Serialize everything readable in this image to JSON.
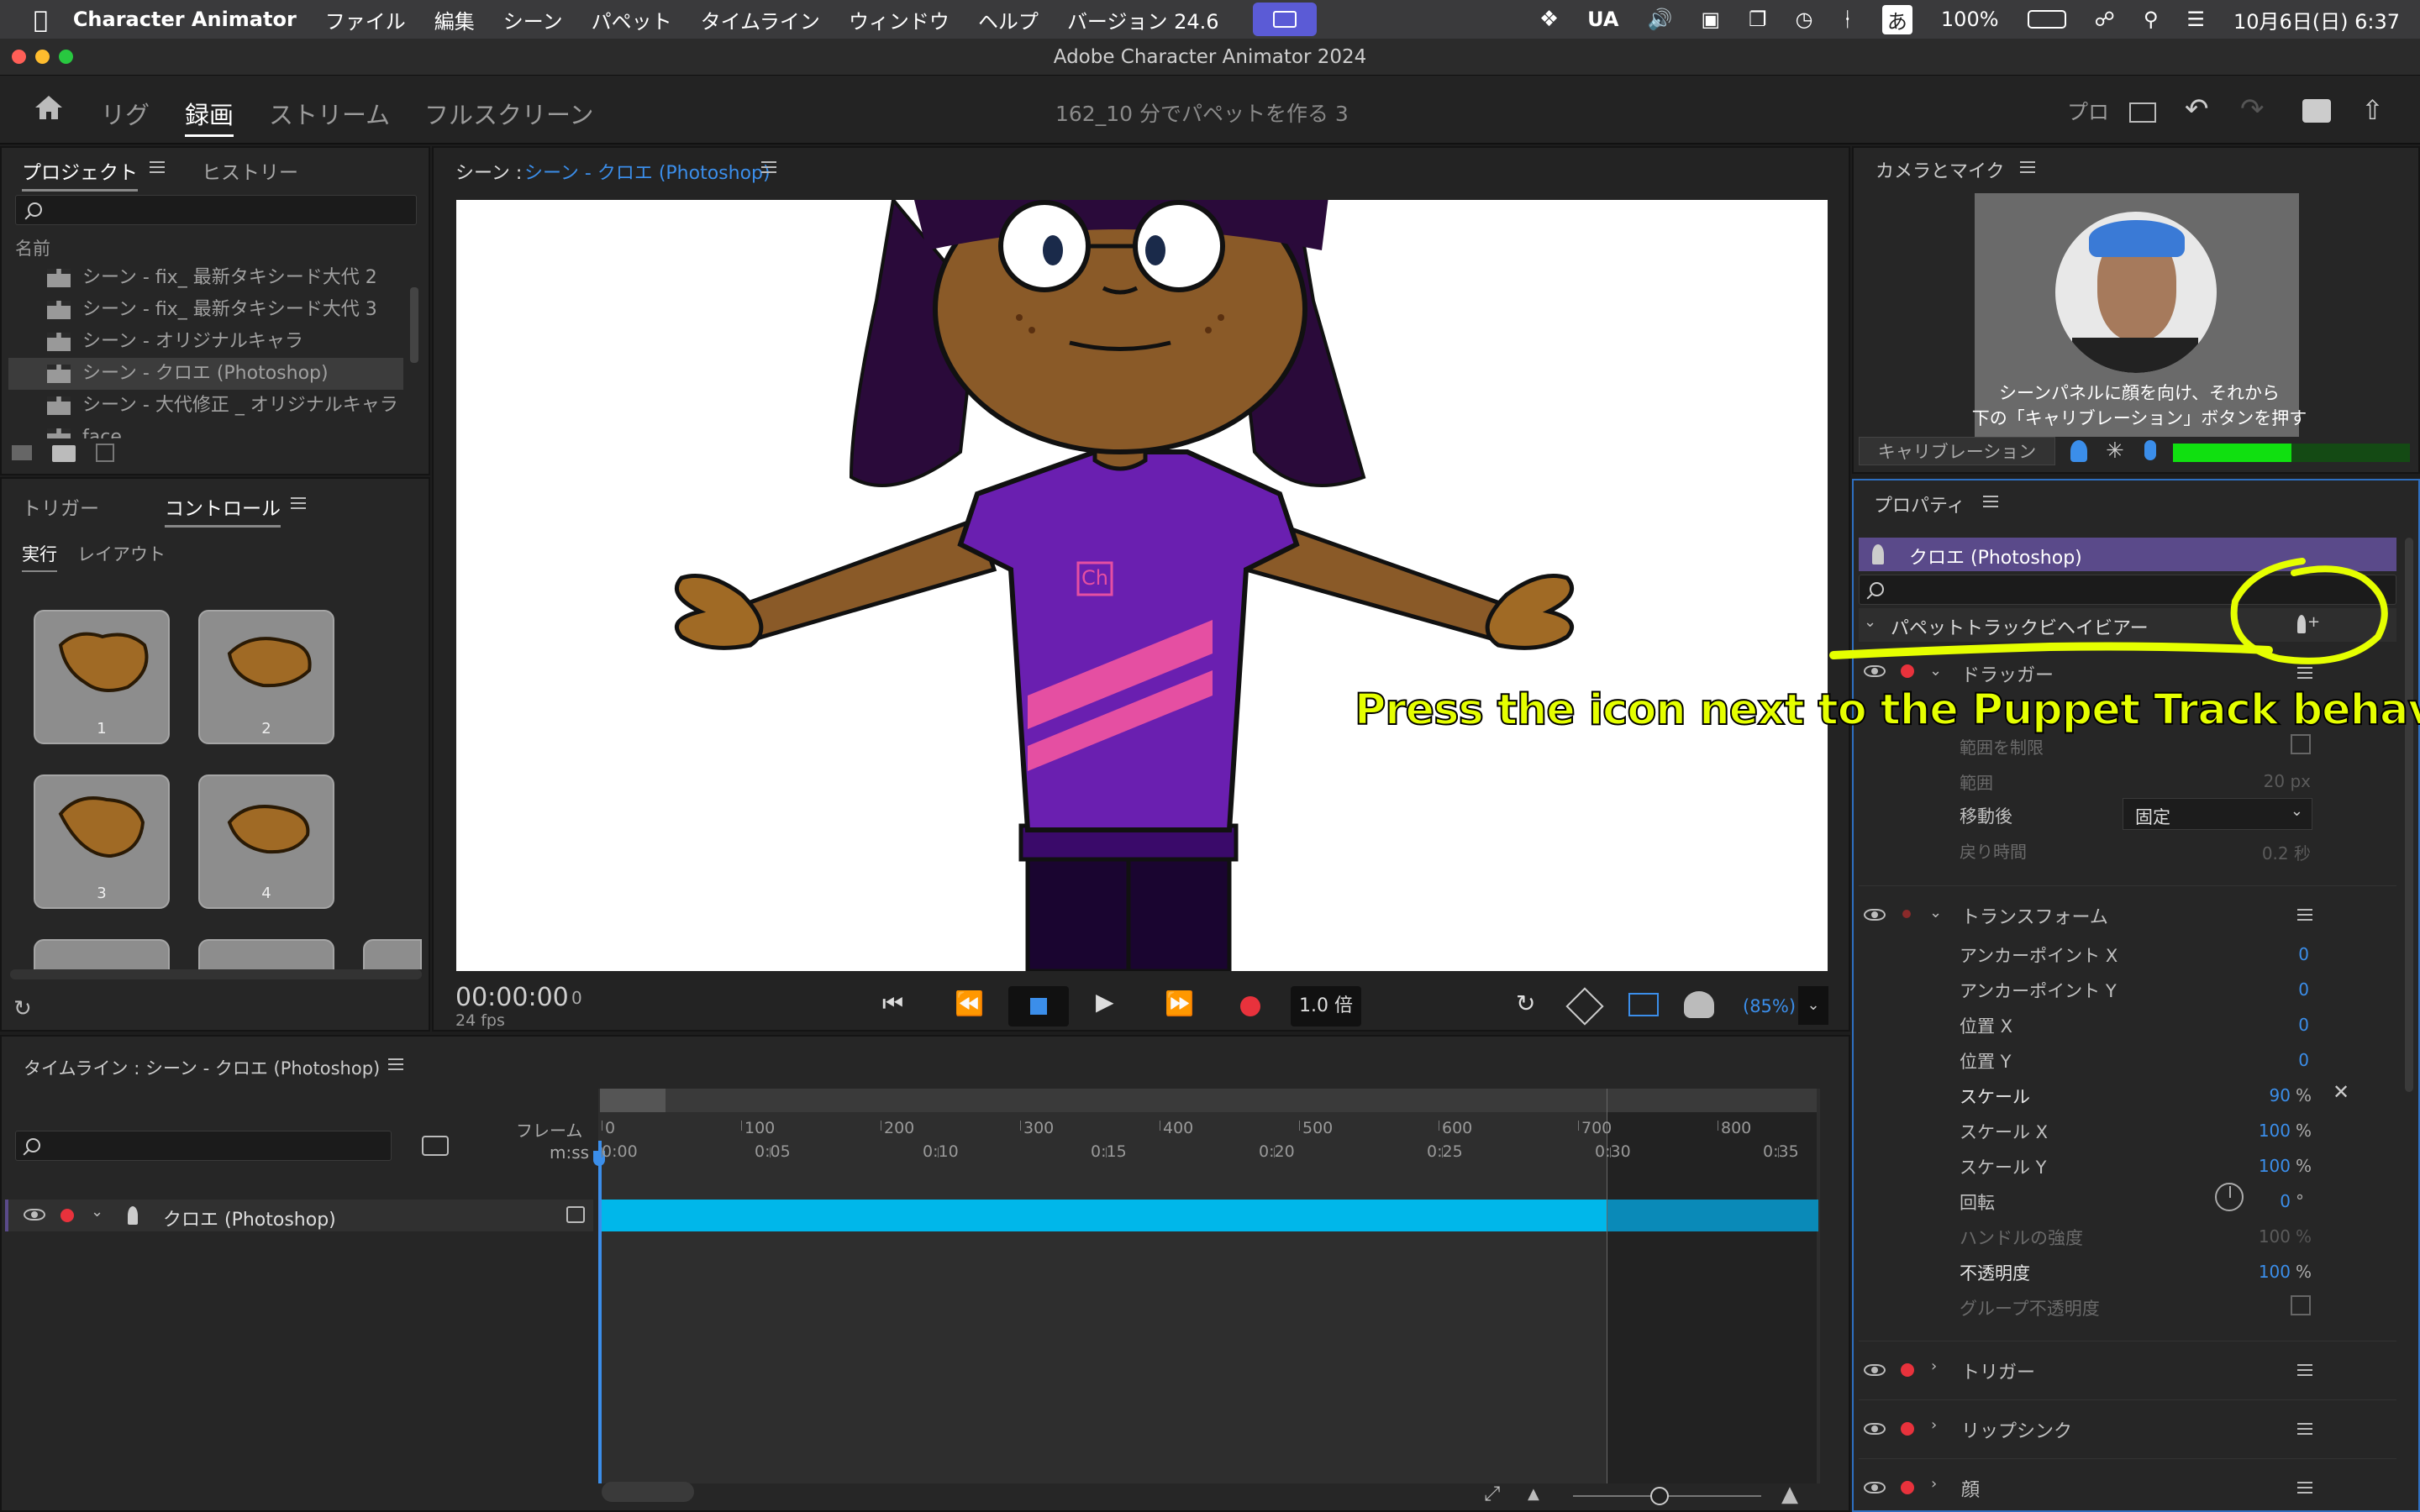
{
  "menubar": {
    "app_name": "Character Animator",
    "items": [
      "ファイル",
      "編集",
      "シーン",
      "パペット",
      "タイムライン",
      "ウィンドウ",
      "ヘルプ",
      "バージョン 24.6"
    ],
    "lang": "UA",
    "ime": "あ",
    "battery": "100%",
    "clock": "10月6日(日) 6:37"
  },
  "window": {
    "title": "Adobe Character Animator 2024"
  },
  "workspace": {
    "tabs": [
      "リグ",
      "録画",
      "ストリーム",
      "フルスクリーン"
    ],
    "active": "録画",
    "doc_title": "162_10 分でパペットを作る 3",
    "pro_label": "プロ"
  },
  "project_panel": {
    "tabs": [
      "プロジェクト",
      "ヒストリー"
    ],
    "column_header": "名前",
    "items": [
      {
        "label": "シーン - fix_ 最新タキシード大代 2",
        "selected": false
      },
      {
        "label": "シーン - fix_ 最新タキシード大代 3",
        "selected": false
      },
      {
        "label": "シーン - オリジナルキャラ",
        "selected": false
      },
      {
        "label": "シーン - クロエ (Photoshop)",
        "selected": true
      },
      {
        "label": "シーン - 大代修正 _ オリジナルキャラ",
        "selected": false
      },
      {
        "label": "face",
        "selected": false
      }
    ]
  },
  "controls_panel": {
    "tabs": [
      "トリガー",
      "コントロール"
    ],
    "subtabs": [
      "実行",
      "レイアウト"
    ],
    "tiles": [
      "1",
      "2",
      "3",
      "4"
    ]
  },
  "scene_panel": {
    "label_prefix": "シーン :",
    "scene_name": "シーン - クロエ (Photoshop)",
    "shirt_logo": "Ch",
    "timecode": "00:00:00",
    "frame": "0",
    "fps": "24 fps",
    "speed": "1.0 倍",
    "zoom": "(85%)"
  },
  "camera_panel": {
    "title": "カメラとマイク",
    "instruction_line1": "シーンパネルに顔を向け、それから",
    "instruction_line2": "下の「キャリブレーション」ボタンを押す",
    "calibrate_button": "キャリブレーション",
    "mic_level": 0.5
  },
  "properties_panel": {
    "title": "プロパティ",
    "puppet_name": "クロエ (Photoshop)",
    "behavior_header": "パペットトラックビヘイビアー",
    "dragger": {
      "label": "ドラッガー",
      "limit_label": "範囲を制限",
      "range_label": "範囲",
      "range_value": "20 px",
      "after_move_label": "移動後",
      "after_move_value": "固定",
      "return_time_label": "戻り時間",
      "return_time_value": "0.2 秒"
    },
    "transform": {
      "label": "トランスフォーム",
      "rows": [
        {
          "label": "アンカーポイント X",
          "value": "0",
          "unit": ""
        },
        {
          "label": "アンカーポイント Y",
          "value": "0",
          "unit": ""
        },
        {
          "label": "位置 X",
          "value": "0",
          "unit": ""
        },
        {
          "label": "位置 Y",
          "value": "0",
          "unit": ""
        },
        {
          "label": "スケール",
          "value": "90",
          "unit": "%"
        },
        {
          "label": "スケール X",
          "value": "100",
          "unit": "%"
        },
        {
          "label": "スケール Y",
          "value": "100",
          "unit": "%"
        },
        {
          "label": "回転",
          "value": "0",
          "unit": "°"
        },
        {
          "label": "ハンドルの強度",
          "value": "100",
          "unit": "%"
        },
        {
          "label": "不透明度",
          "value": "100",
          "unit": "%"
        },
        {
          "label": "グループ不透明度",
          "value": "",
          "unit": ""
        }
      ]
    },
    "collapsed_behaviors": [
      "トリガー",
      "リップシンク",
      "顔"
    ]
  },
  "annotation": {
    "text": "Press the icon next to the Puppet Track behavior",
    "color": "#e5ff00"
  },
  "timeline_panel": {
    "title": "タイムライン : シーン - クロエ (Photoshop)",
    "frame_label": "フレーム",
    "time_label": "m:ss",
    "frame_ticks": [
      "0",
      "100",
      "200",
      "300",
      "400",
      "500",
      "600",
      "700",
      "800"
    ],
    "time_ticks": [
      "0:00",
      "0:05",
      "0:10",
      "0:15",
      "0:20",
      "0:25",
      "0:30",
      "0:35"
    ],
    "track_name": "クロエ (Photoshop)"
  },
  "colors": {
    "accent_blue": "#3b8eea",
    "track_cyan": "#00b7ea",
    "record_red": "#e8323c",
    "puppet_header": "#5a4a8a",
    "shirt_purple": "#6a1fb0",
    "skin": "#8a5a28",
    "hair": "#2a0a3a"
  }
}
